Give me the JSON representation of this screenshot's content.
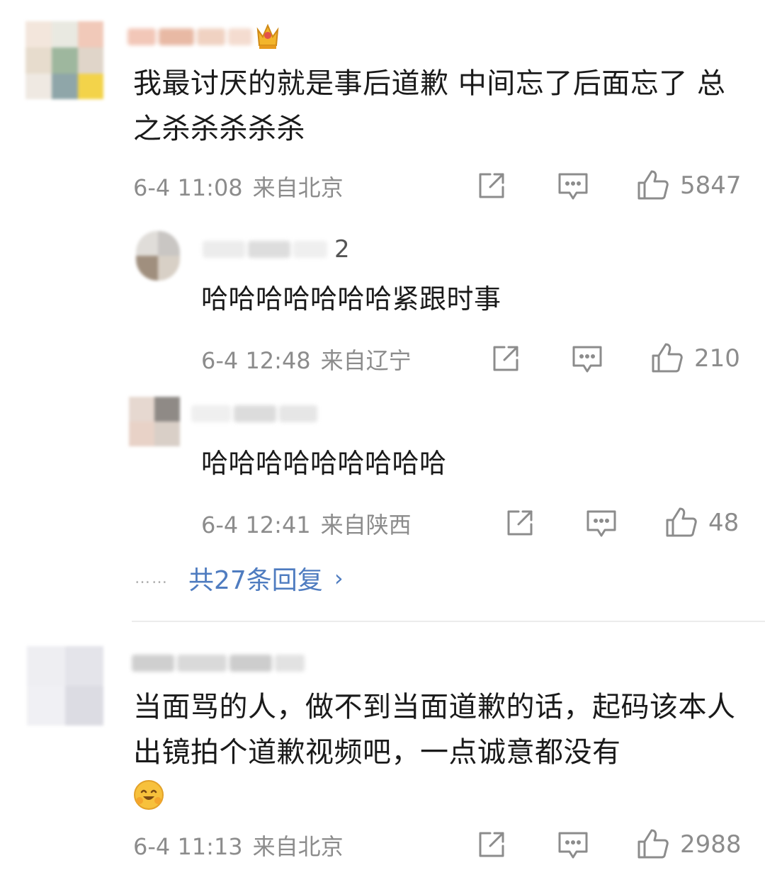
{
  "comments": [
    {
      "text": "我最讨厌的就是事后道歉 中间忘了后面忘了 总之杀杀杀杀杀",
      "time": "6-4 11:08",
      "location": "来自北京",
      "likes": "5847"
    },
    {
      "username_suffix": "2",
      "text": "哈哈哈哈哈哈哈紧跟时事",
      "time": "6-4 12:48",
      "location": "来自辽宁",
      "likes": "210"
    },
    {
      "text": "哈哈哈哈哈哈哈哈哈",
      "time": "6-4 12:41",
      "location": "来自陕西",
      "likes": "48"
    },
    {
      "text": "当面骂的人，做不到当面道歉的话，起码该本人出镜拍个道歉视频吧，一点诚意都没有",
      "emoji": "smiling-hug-emoji",
      "time": "6-4 11:13",
      "location": "来自北京",
      "likes": "2988"
    }
  ],
  "replies_link": {
    "dots": "……",
    "label": "共27条回复",
    "chevron": "›"
  },
  "icons": {
    "share": "share-icon",
    "comment": "comment-icon",
    "like": "thumbs-up-icon",
    "badge": "crown-badge-icon"
  },
  "colors": {
    "link_blue": "#4f7cc0",
    "meta_gray": "#8c8c8c",
    "text": "#1a1a1a"
  }
}
